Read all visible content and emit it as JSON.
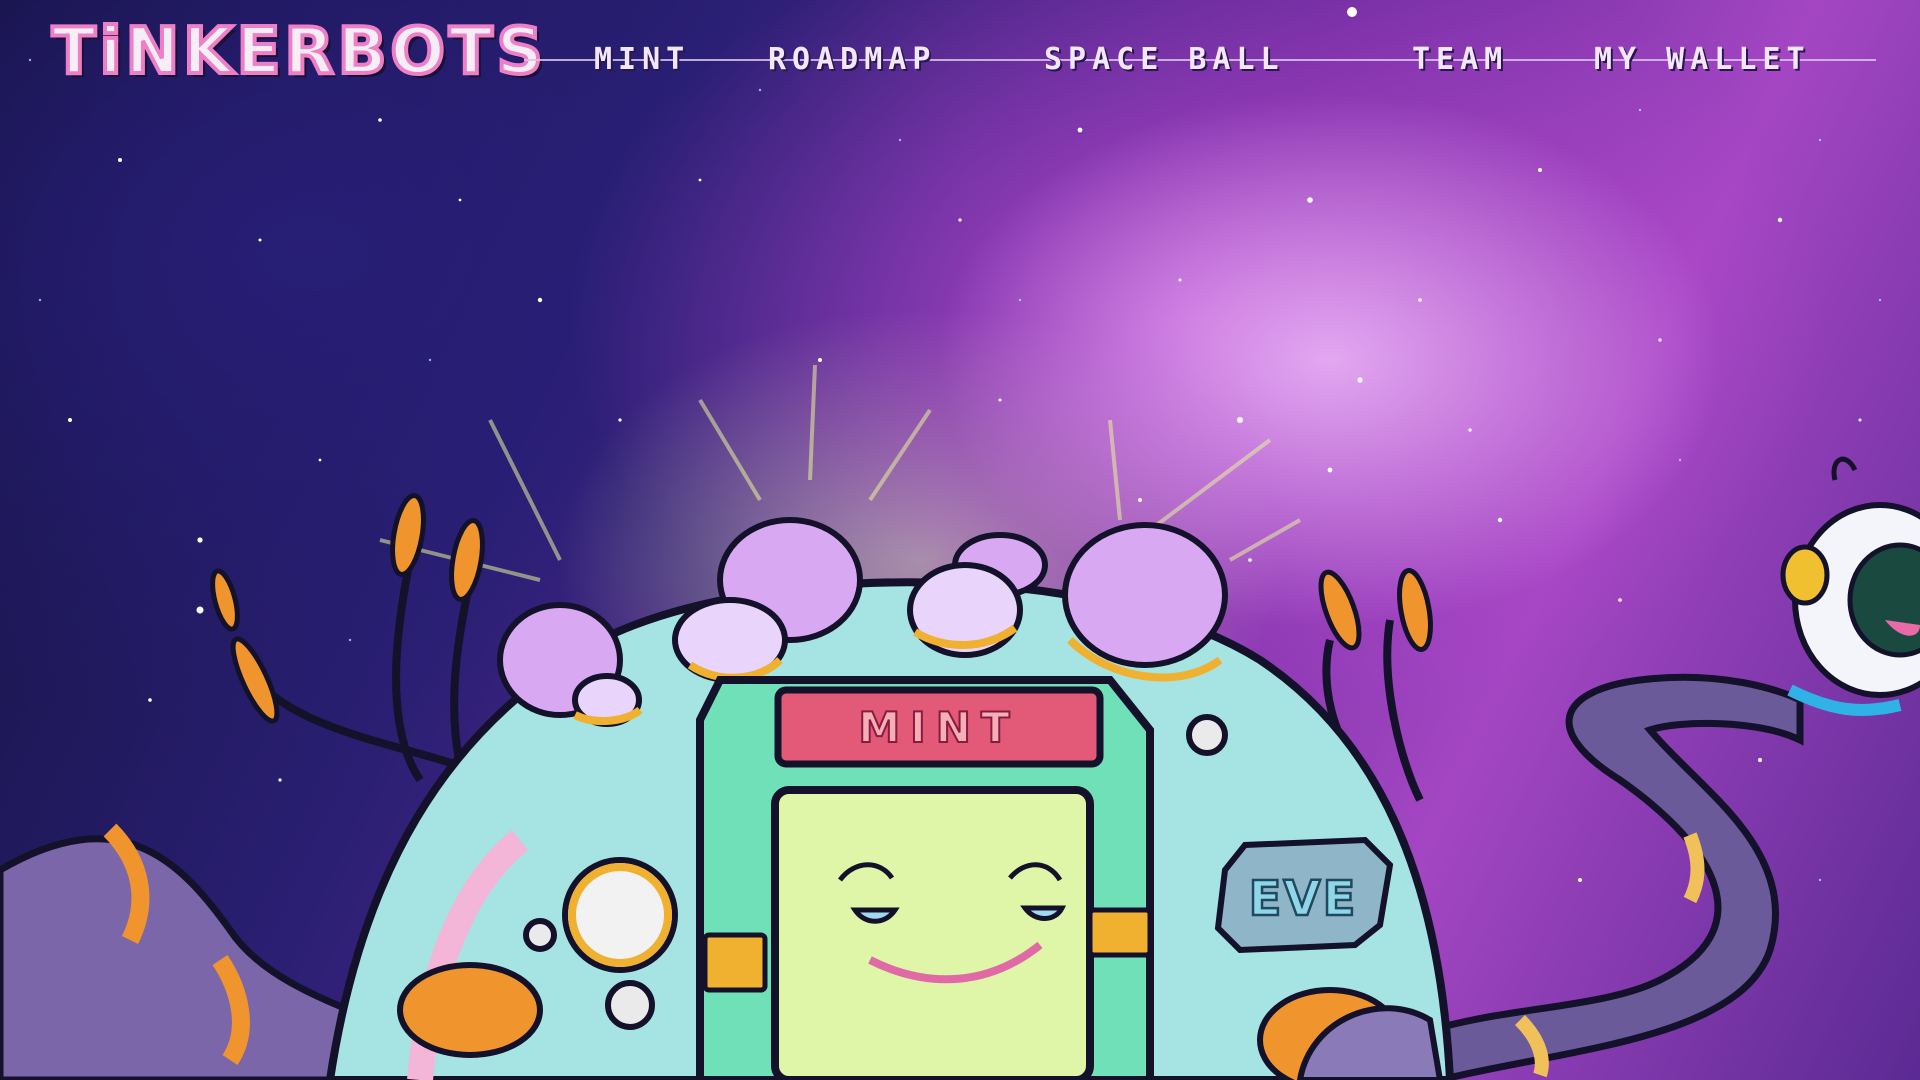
{
  "site": {
    "logo_text": "TiNKERBOTS"
  },
  "nav": {
    "items": [
      {
        "label": "MINT"
      },
      {
        "label": "ROADMAP"
      },
      {
        "label": "SPACE BALL"
      },
      {
        "label": "TEAM"
      },
      {
        "label": "MY WALLET"
      }
    ]
  },
  "machine": {
    "mint_sign": "MINT",
    "badge": "EVE"
  },
  "colors": {
    "logo_outline": "#ee7ec6",
    "nav_text": "#f3e7fb",
    "machine_body": "#a6e3e3",
    "machine_screen": "#dff5a8",
    "sign": "#e25a78",
    "tentacle": "#7a66a8",
    "accent_orange": "#f0952e"
  },
  "icons": [
    "mint-machine-robot",
    "space-robot-mascot"
  ]
}
